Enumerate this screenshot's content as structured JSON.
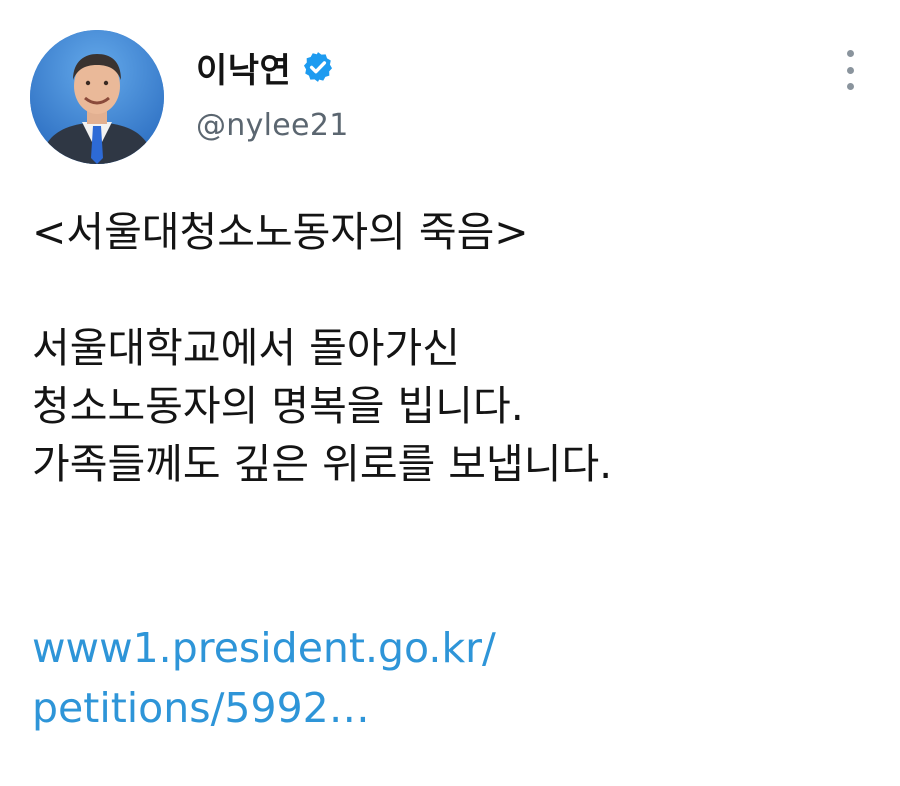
{
  "author": {
    "display_name": "이낙연",
    "handle": "@nylee21",
    "verified": true,
    "avatar": "profile-photo"
  },
  "menu": {
    "icon": "more-vertical-icon"
  },
  "tweet": {
    "lines": [
      "<서울대청소노동자의 죽음>",
      "",
      "서울대학교에서 돌아가신",
      "청소노동자의 명복을 빕니다.",
      "가족들께도 깊은 위로를 보냅니다."
    ],
    "link_lines": [
      "www1.president.go.kr/",
      "petitions/5992…"
    ]
  },
  "colors": {
    "link": "#2e95d8",
    "verified_badge": "#1d9bf0",
    "handle": "#5b6670"
  }
}
